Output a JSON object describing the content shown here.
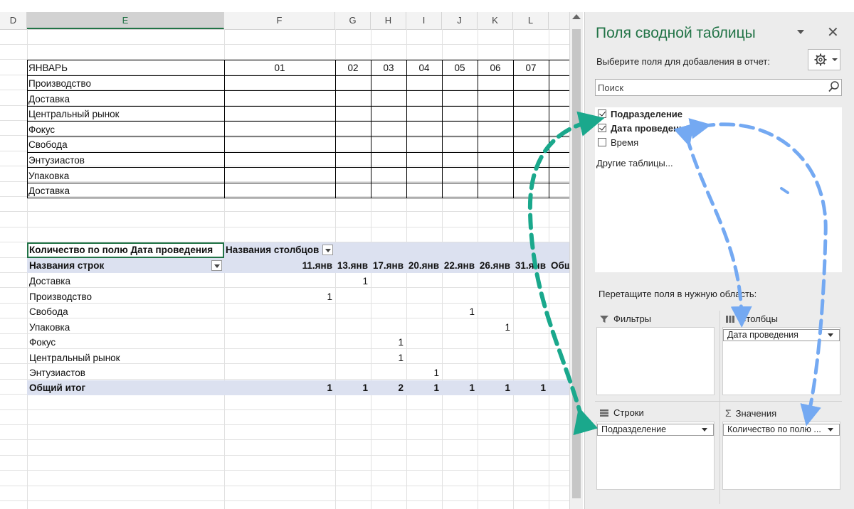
{
  "sheet": {
    "columns": [
      "D",
      "E",
      "F",
      "G",
      "H",
      "I",
      "J",
      "K",
      "L"
    ],
    "selected_column": "E",
    "month_label": "ЯНВАРЬ",
    "day_headers": [
      "01",
      "02",
      "03",
      "04",
      "05",
      "06",
      "07"
    ],
    "departments": [
      "Производство",
      "Доставка",
      "Центральный рынок",
      "Фокус",
      "Свобода",
      "Энтузиастов",
      "Упаковка",
      "Доставка"
    ]
  },
  "pivot": {
    "value_caption": "Количество по полю Дата проведения",
    "column_labels_caption": "Названия столбцов",
    "row_labels_caption": "Названия строк",
    "dates": [
      "11.янв",
      "13.янв",
      "17.янв",
      "20.янв",
      "22.янв",
      "26.янв",
      "31.янв",
      "Общ"
    ],
    "rows": [
      {
        "name": "Доставка",
        "values": [
          "",
          "1",
          "",
          "",
          "",
          "",
          ""
        ]
      },
      {
        "name": "Производство",
        "values": [
          "1",
          "",
          "",
          "",
          "",
          "",
          ""
        ]
      },
      {
        "name": "Свобода",
        "values": [
          "",
          "",
          "",
          "",
          "1",
          "",
          ""
        ]
      },
      {
        "name": "Упаковка",
        "values": [
          "",
          "",
          "",
          "",
          "",
          "1",
          ""
        ]
      },
      {
        "name": "Фокус",
        "values": [
          "",
          "",
          "1",
          "",
          "",
          "",
          ""
        ]
      },
      {
        "name": "Центральный рынок",
        "values": [
          "",
          "",
          "1",
          "",
          "",
          "",
          ""
        ]
      },
      {
        "name": "Энтузиастов",
        "values": [
          "",
          "",
          "",
          "1",
          "",
          "",
          ""
        ]
      }
    ],
    "grand_total_label": "Общий итог",
    "grand_total_values": [
      "1",
      "1",
      "2",
      "1",
      "1",
      "1",
      "1"
    ]
  },
  "pane": {
    "title": "Поля сводной таблицы",
    "subtitle": "Выберите поля для добавления в отчет:",
    "search_placeholder": "Поиск",
    "fields": [
      {
        "label": "Подразделение",
        "checked": true
      },
      {
        "label": "Дата проведения",
        "checked": true
      },
      {
        "label": "Время",
        "checked": false
      }
    ],
    "other_tables_link": "Другие таблицы...",
    "drag_hint": "Перетащите поля в нужную область:",
    "areas": {
      "filters_label": "Фильтры",
      "columns_label": "Столбцы",
      "columns_item": "Дата проведения",
      "rows_label": "Строки",
      "rows_item": "Подразделение",
      "values_label": "Значения",
      "values_item": "Количество по полю ..."
    }
  },
  "colors": {
    "excel_green": "#217346",
    "pivot_band": "#dce1f0",
    "arrow_teal": "#1aa88c",
    "arrow_blue": "#74a9f2"
  }
}
